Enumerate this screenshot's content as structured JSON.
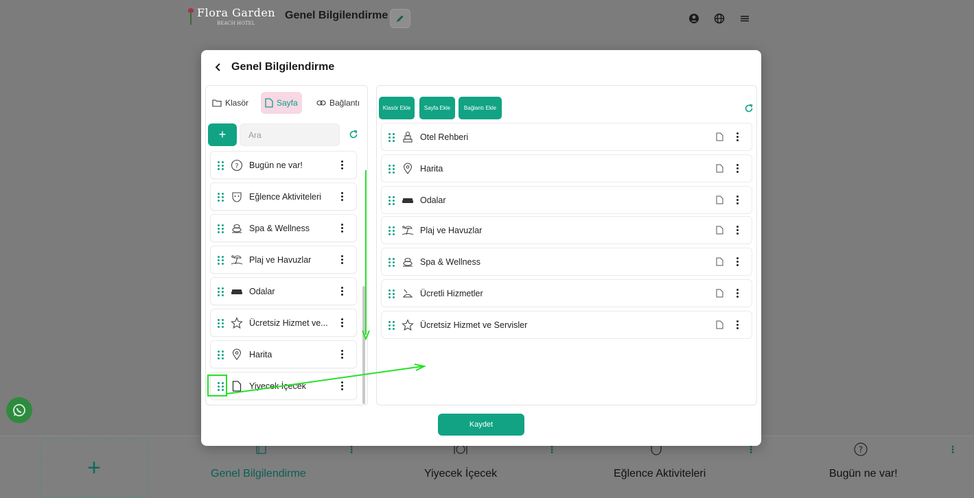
{
  "header": {
    "logo_text": "Flora Garden",
    "logo_subtext": "BEACH HOTEL",
    "title": "Genel Bilgilendirme"
  },
  "bottom_nav": {
    "items": [
      {
        "label": "Genel Bilgilendirme",
        "active": true
      },
      {
        "label": "Yiyecek İçecek",
        "active": false
      },
      {
        "label": "Eğlence Aktiviteleri",
        "active": false
      },
      {
        "label": "Bugün ne var!",
        "active": false
      }
    ]
  },
  "modal": {
    "title": "Genel Bilgilendirme",
    "filter_tabs": [
      {
        "label": "Klasör",
        "icon": "folder-icon",
        "active": false
      },
      {
        "label": "Sayfa",
        "icon": "page-icon",
        "active": true
      },
      {
        "label": "Bağlantı",
        "icon": "link-icon",
        "active": false
      }
    ],
    "add_label": "+",
    "search_placeholder": "Ara",
    "left_items": [
      {
        "label": "Bugün ne var!",
        "icon": "question-icon"
      },
      {
        "label": "Eğlence Aktiviteleri",
        "icon": "mask-icon"
      },
      {
        "label": "Spa & Wellness",
        "icon": "spa-stones-icon"
      },
      {
        "label": "Plaj ve Havuzlar",
        "icon": "beach-icon"
      },
      {
        "label": "Odalar",
        "icon": "bed-icon"
      },
      {
        "label": "Ücretsiz Hizmet ve...",
        "icon": "star-icon"
      },
      {
        "label": "Harita",
        "icon": "map-pin-icon"
      },
      {
        "label": "Yiyecek İçecek",
        "icon": "page-icon"
      }
    ],
    "right_actions": [
      "Klasör Ekle",
      "Sayfa Ekle",
      "Bağlantı Ekle"
    ],
    "right_items": [
      {
        "label": "Otel Rehberi",
        "icon": "concierge-icon"
      },
      {
        "label": "Harita",
        "icon": "map-pin-icon"
      },
      {
        "label": "Odalar",
        "icon": "bed-icon"
      },
      {
        "label": "Plaj ve Havuzlar",
        "icon": "beach-icon"
      },
      {
        "label": "Spa & Wellness",
        "icon": "spa-stones-icon"
      },
      {
        "label": "Ücretli Hizmetler",
        "icon": "service-bell-icon"
      },
      {
        "label": "Ücretsiz Hizmet ve Servisler",
        "icon": "star-icon"
      }
    ],
    "save_label": "Kaydet"
  },
  "colors": {
    "accent": "#11a384",
    "active_tab_bg": "#f7d8e4",
    "annotation": "#28e028"
  }
}
